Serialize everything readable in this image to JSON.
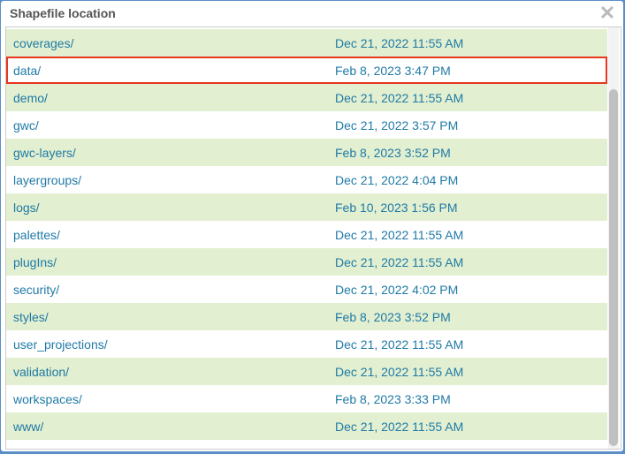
{
  "dialog": {
    "title": "Shapefile location",
    "close_icon": "close-x-icon"
  },
  "colors": {
    "row_alt": "#e2efd0",
    "link": "#1f7aa6",
    "selection_border": "#e8361f"
  },
  "selected_index": 1,
  "rows": [
    {
      "name": "coverages/",
      "date": "Dec 21, 2022 11:55 AM"
    },
    {
      "name": "data/",
      "date": "Feb 8, 2023 3:47 PM"
    },
    {
      "name": "demo/",
      "date": "Dec 21, 2022 11:55 AM"
    },
    {
      "name": "gwc/",
      "date": "Dec 21, 2022 3:57 PM"
    },
    {
      "name": "gwc-layers/",
      "date": "Feb 8, 2023 3:52 PM"
    },
    {
      "name": "layergroups/",
      "date": "Dec 21, 2022 4:04 PM"
    },
    {
      "name": "logs/",
      "date": "Feb 10, 2023 1:56 PM"
    },
    {
      "name": "palettes/",
      "date": "Dec 21, 2022 11:55 AM"
    },
    {
      "name": "plugIns/",
      "date": "Dec 21, 2022 11:55 AM"
    },
    {
      "name": "security/",
      "date": "Dec 21, 2022 4:02 PM"
    },
    {
      "name": "styles/",
      "date": "Feb 8, 2023 3:52 PM"
    },
    {
      "name": "user_projections/",
      "date": "Dec 21, 2022 11:55 AM"
    },
    {
      "name": "validation/",
      "date": "Dec 21, 2022 11:55 AM"
    },
    {
      "name": "workspaces/",
      "date": "Feb 8, 2023 3:33 PM"
    },
    {
      "name": "www/",
      "date": "Dec 21, 2022 11:55 AM"
    }
  ]
}
